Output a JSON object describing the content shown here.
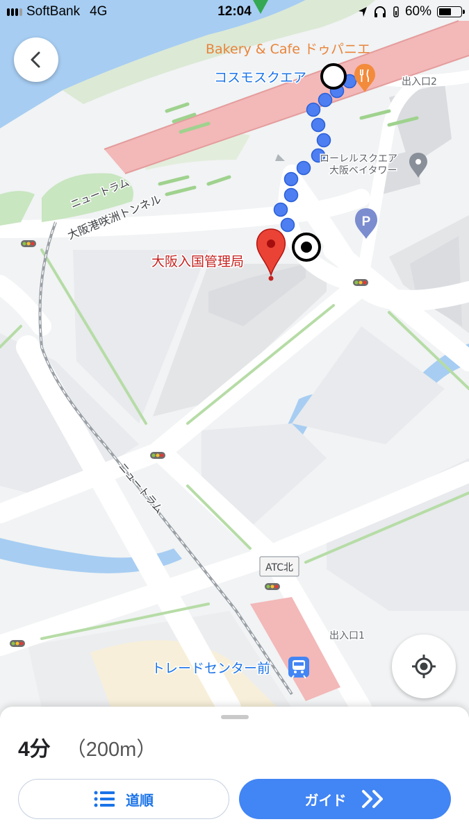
{
  "status_bar": {
    "carrier": "SoftBank",
    "network": "4G",
    "time": "12:04",
    "battery": "60%",
    "battery_level": 0.6
  },
  "map": {
    "labels": {
      "cafe": "Bakery & Cafe ドゥパニエ",
      "cosmo_square": "コスモスクエア",
      "exit2": "出入口2",
      "laurel_1": "ローレルスクエア",
      "laurel_2": "大阪ベイタワー",
      "newtram_top": "ニュートラム",
      "tunnel": "大阪港咲洲トンネル",
      "destination": "大阪入国管理局",
      "newtram_mid": "ニュートラム",
      "atc_kita": "ATC北",
      "exit1": "出入口1",
      "trade_center": "トレードセンター前",
      "parking": "P"
    },
    "icons": [
      "restaurant-icon",
      "place-icon",
      "parking-icon",
      "train-station-icon",
      "destination-pin-icon",
      "target-icon"
    ]
  },
  "sheet": {
    "time": "4分",
    "distance": "（200m）",
    "steps_label": "道順",
    "guide_label": "ガイド"
  },
  "colors": {
    "accent": "#4285f4",
    "route_dot": "#4d7ef2",
    "pin": "#c5221f",
    "water": "#a7cdf2",
    "rail": "#f0b1b1"
  }
}
